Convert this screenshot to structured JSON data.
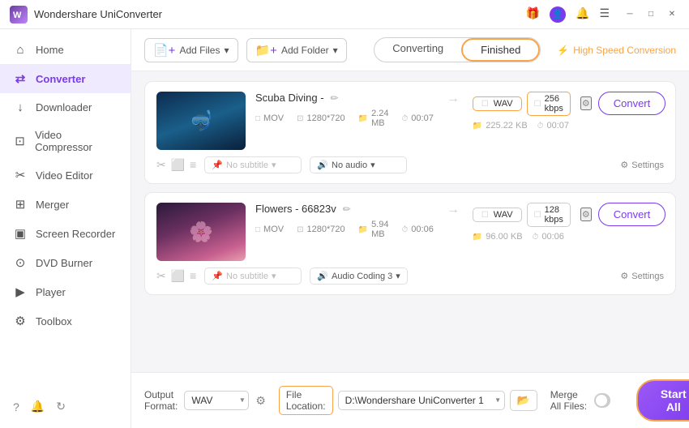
{
  "app": {
    "title": "Wondershare UniConverter",
    "logo_text": "W"
  },
  "titlebar": {
    "gift_icon": "🎁",
    "user_icon": "👤",
    "bell_icon": "🔔",
    "menu_icon": "☰",
    "minimize_icon": "─",
    "maximize_icon": "□",
    "close_icon": "✕"
  },
  "sidebar": {
    "items": [
      {
        "id": "home",
        "label": "Home",
        "icon": "⌂"
      },
      {
        "id": "converter",
        "label": "Converter",
        "icon": "⇄",
        "active": true
      },
      {
        "id": "downloader",
        "label": "Downloader",
        "icon": "↓"
      },
      {
        "id": "video-compressor",
        "label": "Video Compressor",
        "icon": "⊡"
      },
      {
        "id": "video-editor",
        "label": "Video Editor",
        "icon": "✂"
      },
      {
        "id": "merger",
        "label": "Merger",
        "icon": "⊞"
      },
      {
        "id": "screen-recorder",
        "label": "Screen Recorder",
        "icon": "▣"
      },
      {
        "id": "dvd-burner",
        "label": "DVD Burner",
        "icon": "⊙"
      },
      {
        "id": "player",
        "label": "Player",
        "icon": "▶"
      },
      {
        "id": "toolbox",
        "label": "Toolbox",
        "icon": "⚙"
      }
    ],
    "bottom_icons": [
      "?",
      "🔔",
      "↻"
    ]
  },
  "toolbar": {
    "add_file_label": "Add Files",
    "add_folder_label": "Add Folder",
    "tab_converting": "Converting",
    "tab_finished": "Finished",
    "high_speed_label": "High Speed Conversion"
  },
  "files": [
    {
      "id": "file1",
      "name": "Scuba Diving -",
      "thumb_type": "scuba",
      "source_format": "MOV",
      "source_resolution": "1280*720",
      "source_size": "2.24 MB",
      "source_duration": "00:07",
      "output_format": "WAV",
      "output_kbps": "256 kbps",
      "output_size": "225.22 KB",
      "output_duration": "00:07",
      "subtitle": "No subtitle",
      "audio": "No audio",
      "convert_btn": "Convert"
    },
    {
      "id": "file2",
      "name": "Flowers - 66823v",
      "thumb_type": "flowers",
      "source_format": "MOV",
      "source_resolution": "1280*720",
      "source_size": "5.94 MB",
      "source_duration": "00:06",
      "output_format": "WAV",
      "output_kbps": "128 kbps",
      "output_size": "96.00 KB",
      "output_duration": "00:06",
      "subtitle": "No subtitle",
      "audio": "Audio Coding 3",
      "convert_btn": "Convert"
    }
  ],
  "bottom": {
    "output_format_label": "Output Format:",
    "output_format_value": "WAV",
    "file_location_label": "File Location:",
    "file_path": "D:\\Wondershare UniConverter 1",
    "merge_label": "Merge All Files:",
    "start_all_label": "Start All",
    "settings_label": "Settings"
  }
}
